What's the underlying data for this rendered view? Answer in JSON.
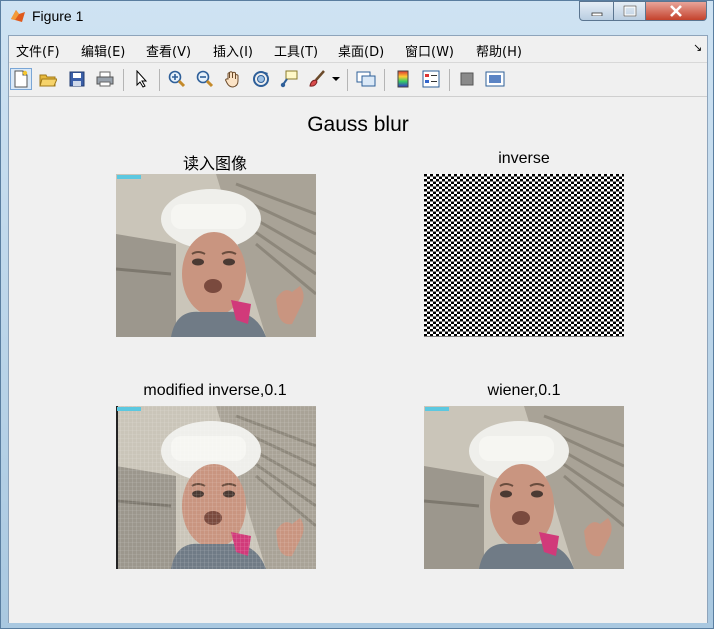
{
  "window": {
    "title": "Figure 1",
    "controls": {
      "minimize": "—",
      "maximize": "☐",
      "close": "✕"
    }
  },
  "menu": {
    "items": [
      "文件(F)",
      "编辑(E)",
      "查看(V)",
      "插入(I)",
      "工具(T)",
      "桌面(D)",
      "窗口(W)",
      "帮助(H)"
    ],
    "overflow_glyph": "↘"
  },
  "toolbar": {
    "icons": [
      "new-figure-icon",
      "open-file-icon",
      "save-icon",
      "print-icon",
      "edit-plot-arrow-icon",
      "zoom-in-icon",
      "zoom-out-icon",
      "pan-hand-icon",
      "rotate-3d-icon",
      "data-cursor-icon",
      "brush-icon",
      "brush-dropdown-icon",
      "link-plot-icon",
      "colorbar-icon",
      "legend-icon",
      "hide-plot-tools-icon",
      "show-plot-tools-icon"
    ]
  },
  "figure": {
    "suptitle": "Gauss blur",
    "axes": [
      {
        "title": "读入图像",
        "image": "face-original"
      },
      {
        "title": "inverse",
        "image": "checker-noise"
      },
      {
        "title": "modified inverse,0.1",
        "image": "face-restored-grid"
      },
      {
        "title": "wiener,0.1",
        "image": "face-restored"
      }
    ]
  },
  "colors": {
    "face_bg": "#b2aea3",
    "helmet": "#f2f2ee",
    "skin": "#c9967f",
    "shirt": "#707b86",
    "collar": "#d13a7a"
  }
}
